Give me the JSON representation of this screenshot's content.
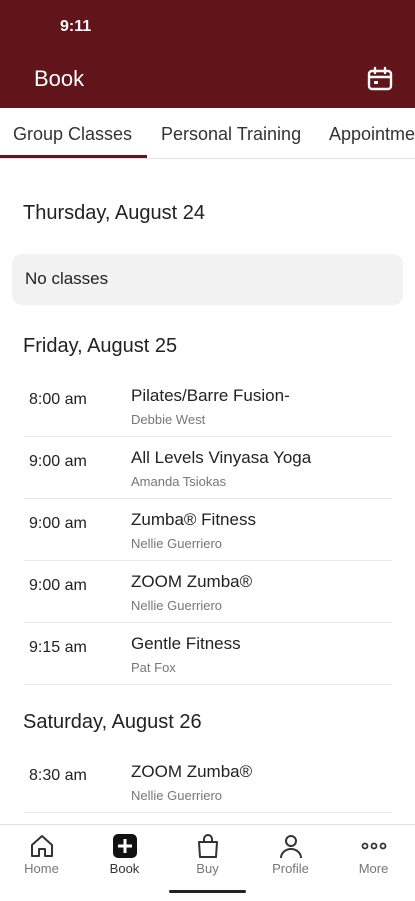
{
  "status_bar": {
    "time": "9:11"
  },
  "header": {
    "title": "Book",
    "background": "#611419"
  },
  "tabs": [
    {
      "label": "Group Classes",
      "selected": true
    },
    {
      "label": "Personal Training",
      "selected": false
    },
    {
      "label": "Appointme",
      "selected": false
    }
  ],
  "days": [
    {
      "heading": "Thursday, August 24",
      "empty_text": "No classes"
    },
    {
      "heading": "Friday, August 25",
      "classes": [
        {
          "time": "8:00 am",
          "name": "Pilates/Barre Fusion-",
          "instructor": "Debbie West"
        },
        {
          "time": "9:00 am",
          "name": "All Levels Vinyasa Yoga",
          "instructor": "Amanda Tsiokas"
        },
        {
          "time": "9:00 am",
          "name": "Zumba® Fitness",
          "instructor": "Nellie Guerriero"
        },
        {
          "time": "9:00 am",
          "name": "ZOOM Zumba®",
          "instructor": "Nellie Guerriero"
        },
        {
          "time": "9:15 am",
          "name": "Gentle Fitness",
          "instructor": "Pat Fox"
        }
      ]
    },
    {
      "heading": "Saturday, August 26",
      "classes": [
        {
          "time": "8:30 am",
          "name": "ZOOM Zumba®",
          "instructor": "Nellie Guerriero"
        }
      ]
    }
  ],
  "bottom_nav": [
    {
      "label": "Home",
      "icon": "home-icon"
    },
    {
      "label": "Book",
      "icon": "plus-square-icon",
      "active": true
    },
    {
      "label": "Buy",
      "icon": "shopping-bag-icon"
    },
    {
      "label": "Profile",
      "icon": "person-icon"
    },
    {
      "label": "More",
      "icon": "more-dots-icon"
    }
  ]
}
